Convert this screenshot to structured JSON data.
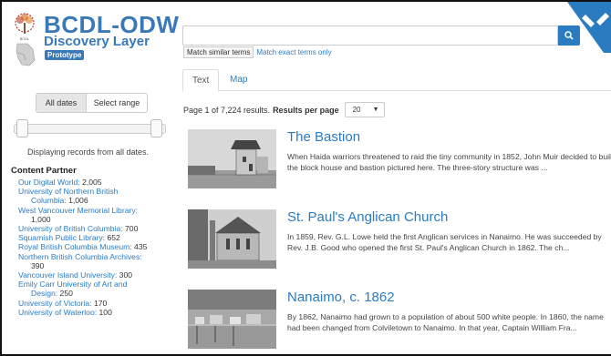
{
  "header": {
    "title": "BCDL-ODW",
    "subtitle": "Discovery Layer",
    "badge": "Prototype"
  },
  "search": {
    "value": "",
    "placeholder": "",
    "match_similar": "Match similar terms",
    "match_exact": "Match exact terms only"
  },
  "tabs": [
    {
      "label": "Text"
    },
    {
      "label": "Map"
    }
  ],
  "results": {
    "page_summary": "Page 1 of 7,224 results.",
    "per_page_label": "Results per page",
    "per_page_value": "20"
  },
  "sidebar": {
    "date_all": "All dates",
    "date_range": "Select range",
    "displaying": "Displaying records from all dates.",
    "content_partner_title": "Content Partner",
    "partners": [
      {
        "name": "Our Digital World",
        "count": "2,005"
      },
      {
        "name": "University of Northern British",
        "name2": "Columbia",
        "count": "1,006"
      },
      {
        "name": "West Vancouver Memorial Library",
        "count": "1,000"
      },
      {
        "name": "University of British Columbia",
        "count": "700"
      },
      {
        "name": "Squamish Public Library",
        "count": "652"
      },
      {
        "name": "Royal British Columbia Museum",
        "count": "435"
      },
      {
        "name": "Northern British Columbia Archives",
        "count": "390"
      },
      {
        "name": "Vancouver Island University",
        "count": "300"
      },
      {
        "name": "Emily Carr University of Art and",
        "name2": "Design",
        "count": "250"
      },
      {
        "name": "University of Victoria",
        "count": "170"
      },
      {
        "name": "University of Waterloo",
        "count": "100"
      }
    ]
  },
  "items": [
    {
      "title": "The Bastion",
      "description": "When Haida warriors threatened to raid the tiny community in 1852, John Muir decided to build the block house and bastion pictured here. The three-story structure was ..."
    },
    {
      "title": "St. Paul's Anglican Church",
      "description": "In 1859, Rev. G.L. Lowe held the first Anglican services in Nanaimo. He was succeeded by Rev. J.B. Good who opened the first St. Paul's Anglican Church in 1862. The ch..."
    },
    {
      "title": "Nanaimo, c. 1862",
      "description": "By 1862, Nanaimo had grown to a population of about 500 white people. In 1860, the name had been changed from Colviletown to Nanaimo. In that year, Captain William Fra..."
    }
  ],
  "colors": {
    "brand": "#3a79b7",
    "link": "#2b7bc1",
    "button": "#2b7bc1"
  },
  "icons": {
    "search": "search-icon",
    "logo": "tree-logo-icon",
    "map": "bc-map-icon",
    "corner": "corner-badge-icon"
  }
}
